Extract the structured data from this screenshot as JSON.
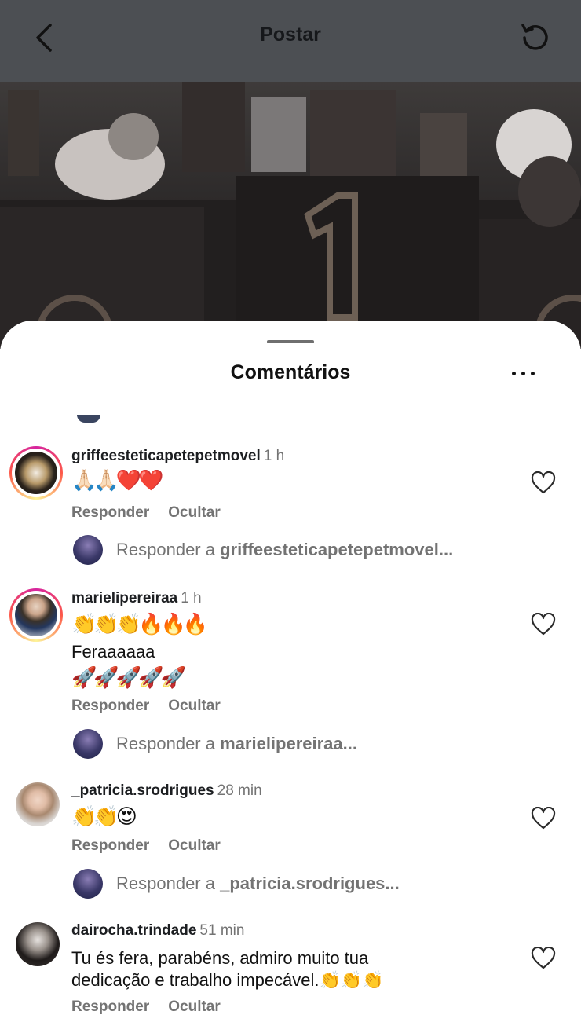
{
  "header": {
    "title": "Postar"
  },
  "sheet": {
    "title": "Comentários"
  },
  "comments": [
    {
      "username": "griffeesteticapetepetmovel",
      "time": "1 h",
      "lines": [
        "🙏🏻🙏🏻❤️❤️"
      ],
      "reply_label": "Responder",
      "hide_label": "Ocultar",
      "reply_prefix": "Responder a",
      "reply_target": "griffeesteticapetepetmovel..."
    },
    {
      "username": "marielipereiraa",
      "time": "1 h",
      "lines": [
        "👏👏👏🔥🔥🔥",
        "Feraaaaaa",
        "🚀🚀🚀🚀🚀"
      ],
      "reply_label": "Responder",
      "hide_label": "Ocultar",
      "reply_prefix": "Responder a",
      "reply_target": "marielipereiraa..."
    },
    {
      "username": "_patricia.srodrigues",
      "time": "28 min",
      "lines": [
        "👏👏😍"
      ],
      "reply_label": "Responder",
      "hide_label": "Ocultar",
      "reply_prefix": "Responder a",
      "reply_target": "_patricia.srodrigues..."
    },
    {
      "username": "dairocha.trindade",
      "time": "51 min",
      "lines": [
        "Tu és fera, parabéns, admiro muito tua",
        "dedicação e trabalho impecável.👏👏👏"
      ],
      "reply_label": "Responder",
      "hide_label": "Ocultar"
    }
  ],
  "icons": {
    "back": "chevron-left-icon",
    "refresh": "refresh-icon",
    "more": "more-horizontal-icon",
    "like": "heart-icon"
  }
}
